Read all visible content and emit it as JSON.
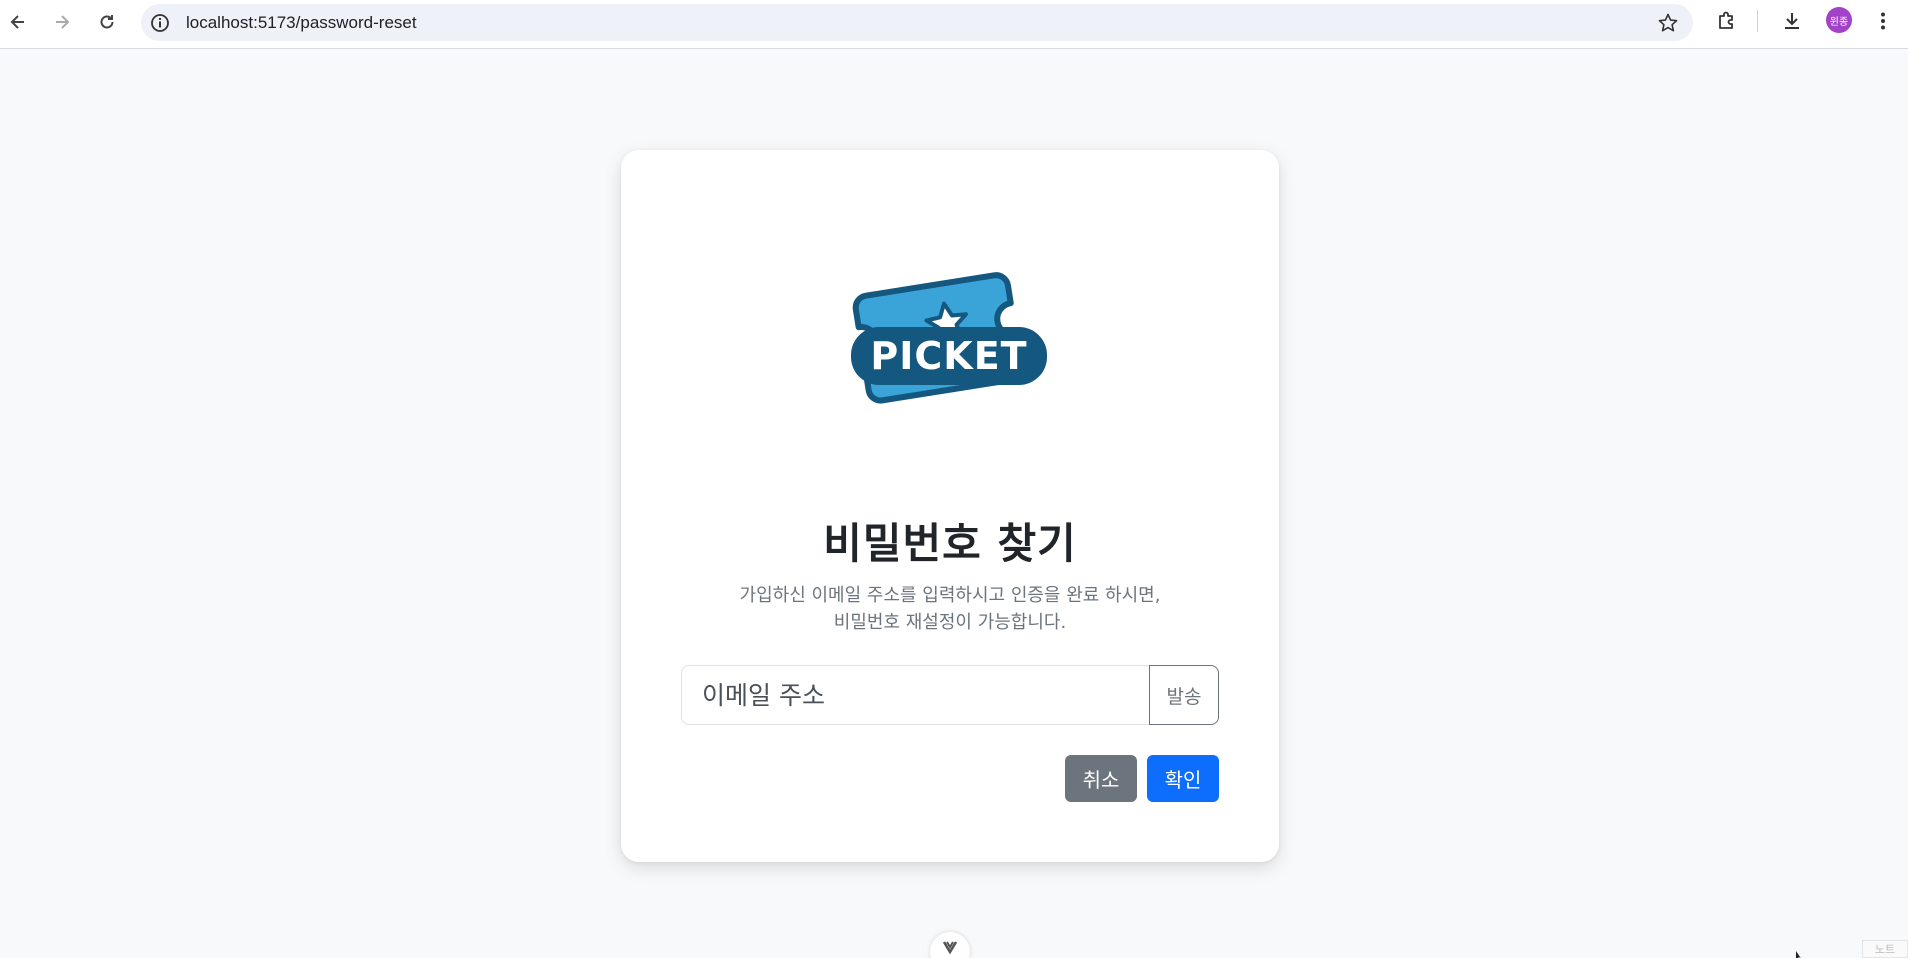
{
  "browser": {
    "url": "localhost:5173/password-reset",
    "avatar_text": "윈종",
    "icons": [
      "back-icon",
      "forward-icon",
      "reload-icon",
      "site-info-icon",
      "bookmark-star-icon",
      "extensions-icon",
      "download-icon",
      "menu-kebab-icon"
    ]
  },
  "card": {
    "logo_text": "PICKET",
    "title": "비밀번호 찾기",
    "description_line1": "가입하신 이메일 주소를 입력하시고 인증을 완료 하시면,",
    "description_line2": "비밀번호 재설정이 가능합니다.",
    "email_placeholder": "이메일 주소",
    "send_label": "발송",
    "cancel_label": "취소",
    "confirm_label": "확인"
  },
  "corner_label": "노트",
  "colors": {
    "primary": "#0d6efd",
    "secondary": "#6c757d",
    "logo_dark": "#14577f",
    "logo_light": "#3aa3d8"
  }
}
